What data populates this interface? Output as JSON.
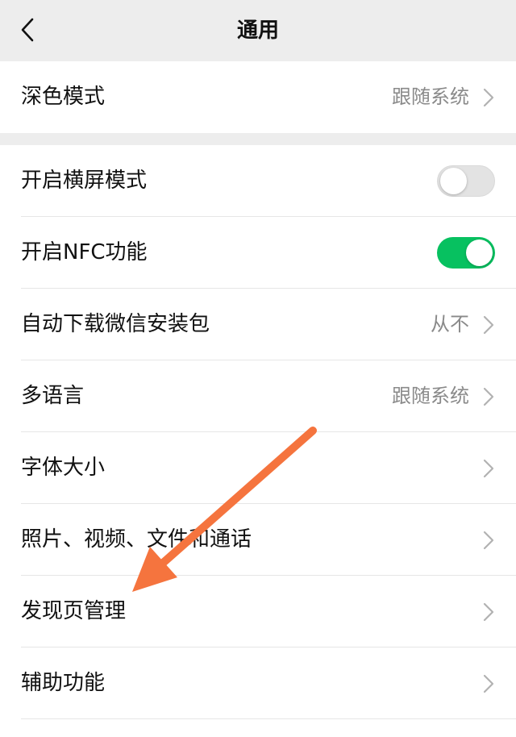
{
  "header": {
    "title": "通用",
    "back_icon": "chevron-left-icon"
  },
  "section_dark_mode": {
    "label": "深色模式",
    "value": "跟随系统"
  },
  "settings": {
    "landscape": {
      "label": "开启横屏模式",
      "toggle_on": false
    },
    "nfc": {
      "label": "开启NFC功能",
      "toggle_on": true
    },
    "auto_download": {
      "label": "自动下载微信安装包",
      "value": "从不"
    },
    "language": {
      "label": "多语言",
      "value": "跟随系统"
    },
    "font_size": {
      "label": "字体大小"
    },
    "media": {
      "label": "照片、视频、文件和通话"
    },
    "discover": {
      "label": "发现页管理"
    },
    "accessibility": {
      "label": "辅助功能"
    }
  },
  "colors": {
    "toggle_on": "#07c160",
    "toggle_off": "#e3e3e3",
    "annotation_arrow": "#f5743e",
    "background": "#ededed"
  }
}
